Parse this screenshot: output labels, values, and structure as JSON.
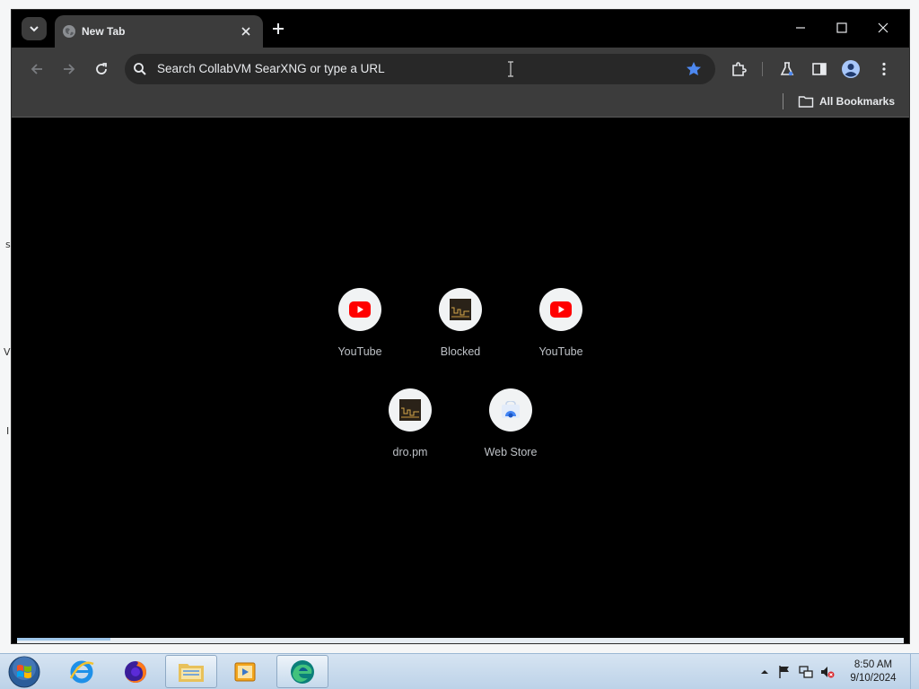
{
  "desktop": {
    "edge_glyphs": [
      "s",
      "V",
      "I"
    ]
  },
  "browser": {
    "tab": {
      "title": "New Tab",
      "favicon": "globe-icon"
    },
    "omnibox": {
      "placeholder": "Search CollabVM SearXNG or type a URL"
    },
    "bookmarks": {
      "all_bookmarks_label": "All Bookmarks"
    },
    "shortcuts": [
      {
        "label": "YouTube",
        "icon": "youtube-icon"
      },
      {
        "label": "Blocked",
        "icon": "dark-thumbnail-icon"
      },
      {
        "label": "YouTube",
        "icon": "youtube-icon"
      },
      {
        "label": "dro.pm",
        "icon": "dark-thumbnail-icon"
      },
      {
        "label": "Web Store",
        "icon": "web-store-icon"
      }
    ],
    "colors": {
      "background": "#000000",
      "toolbar": "#3c3c3c",
      "omnibox": "#282828",
      "accent_star": "#4d88f0"
    }
  },
  "taskbar": {
    "apps": [
      "start-orb",
      "internet-explorer",
      "firefox",
      "file-explorer",
      "media-player",
      "edge-browser"
    ],
    "clock": {
      "time": "8:50 AM",
      "date": "9/10/2024"
    }
  }
}
